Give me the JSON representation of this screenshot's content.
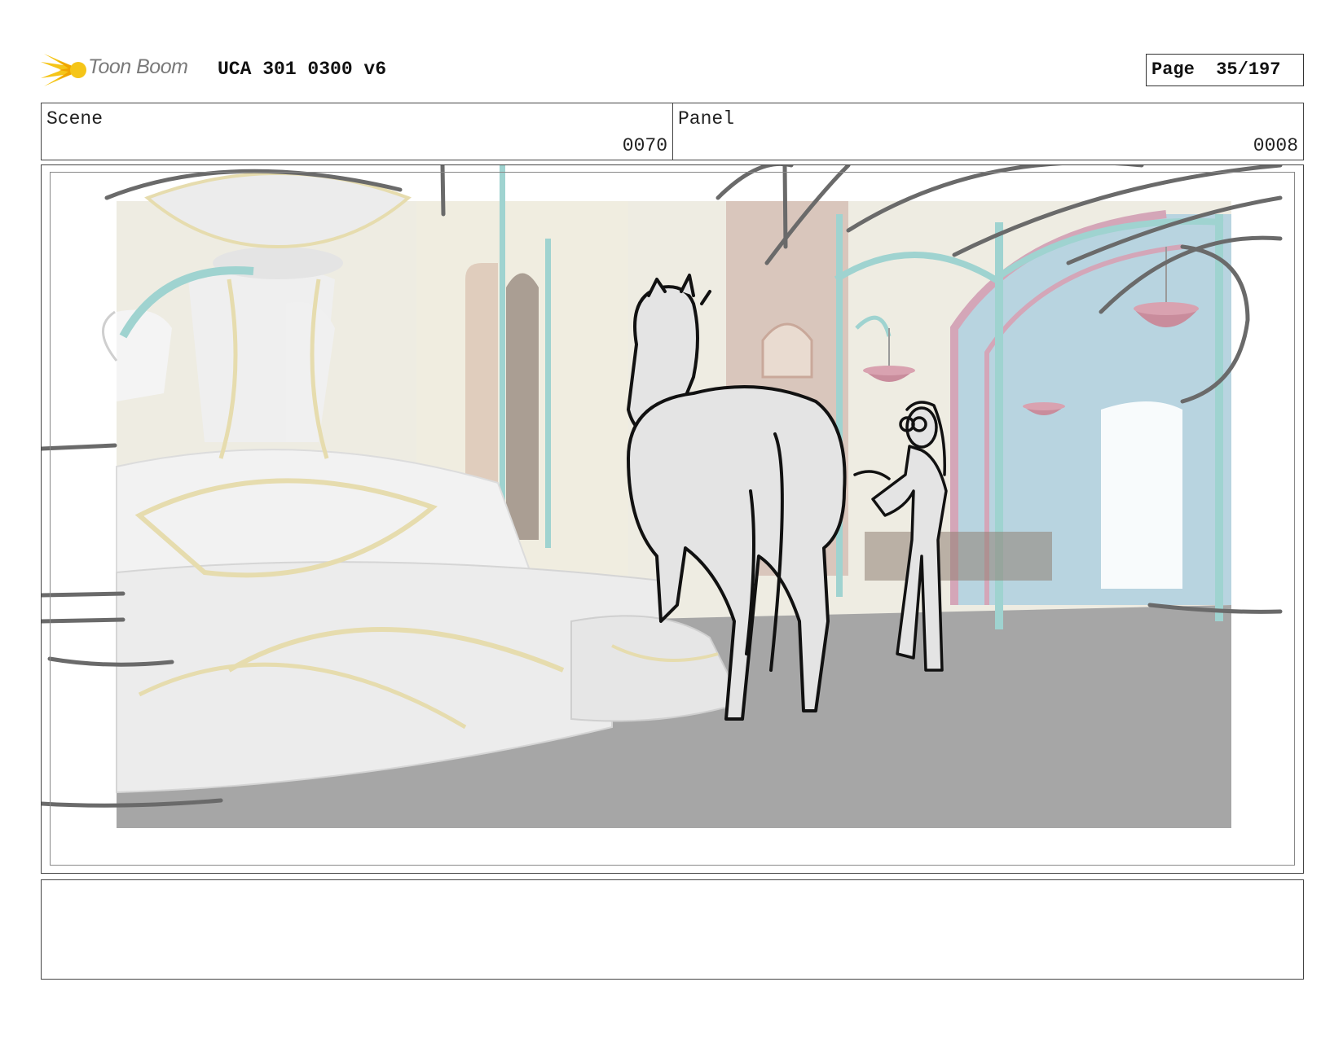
{
  "header": {
    "brand": "Toon Boom",
    "doc_title": "UCA 301 0300 v6",
    "page_label": "Page",
    "page_value": "35/197"
  },
  "info": {
    "scene_label": "Scene",
    "scene_value": "0070",
    "panel_label": "Panel",
    "panel_value": "0008"
  },
  "notes": {
    "text": ""
  },
  "colors": {
    "logo_yellow": "#f5c518",
    "logo_text": "#7a7a7a",
    "floor": "#a6a6a6",
    "sky_blue": "#b8d4e0",
    "pillar_teal": "#9fd3d0",
    "fountain_gold": "#e6dcae",
    "basket_pink": "#c98c9c"
  }
}
